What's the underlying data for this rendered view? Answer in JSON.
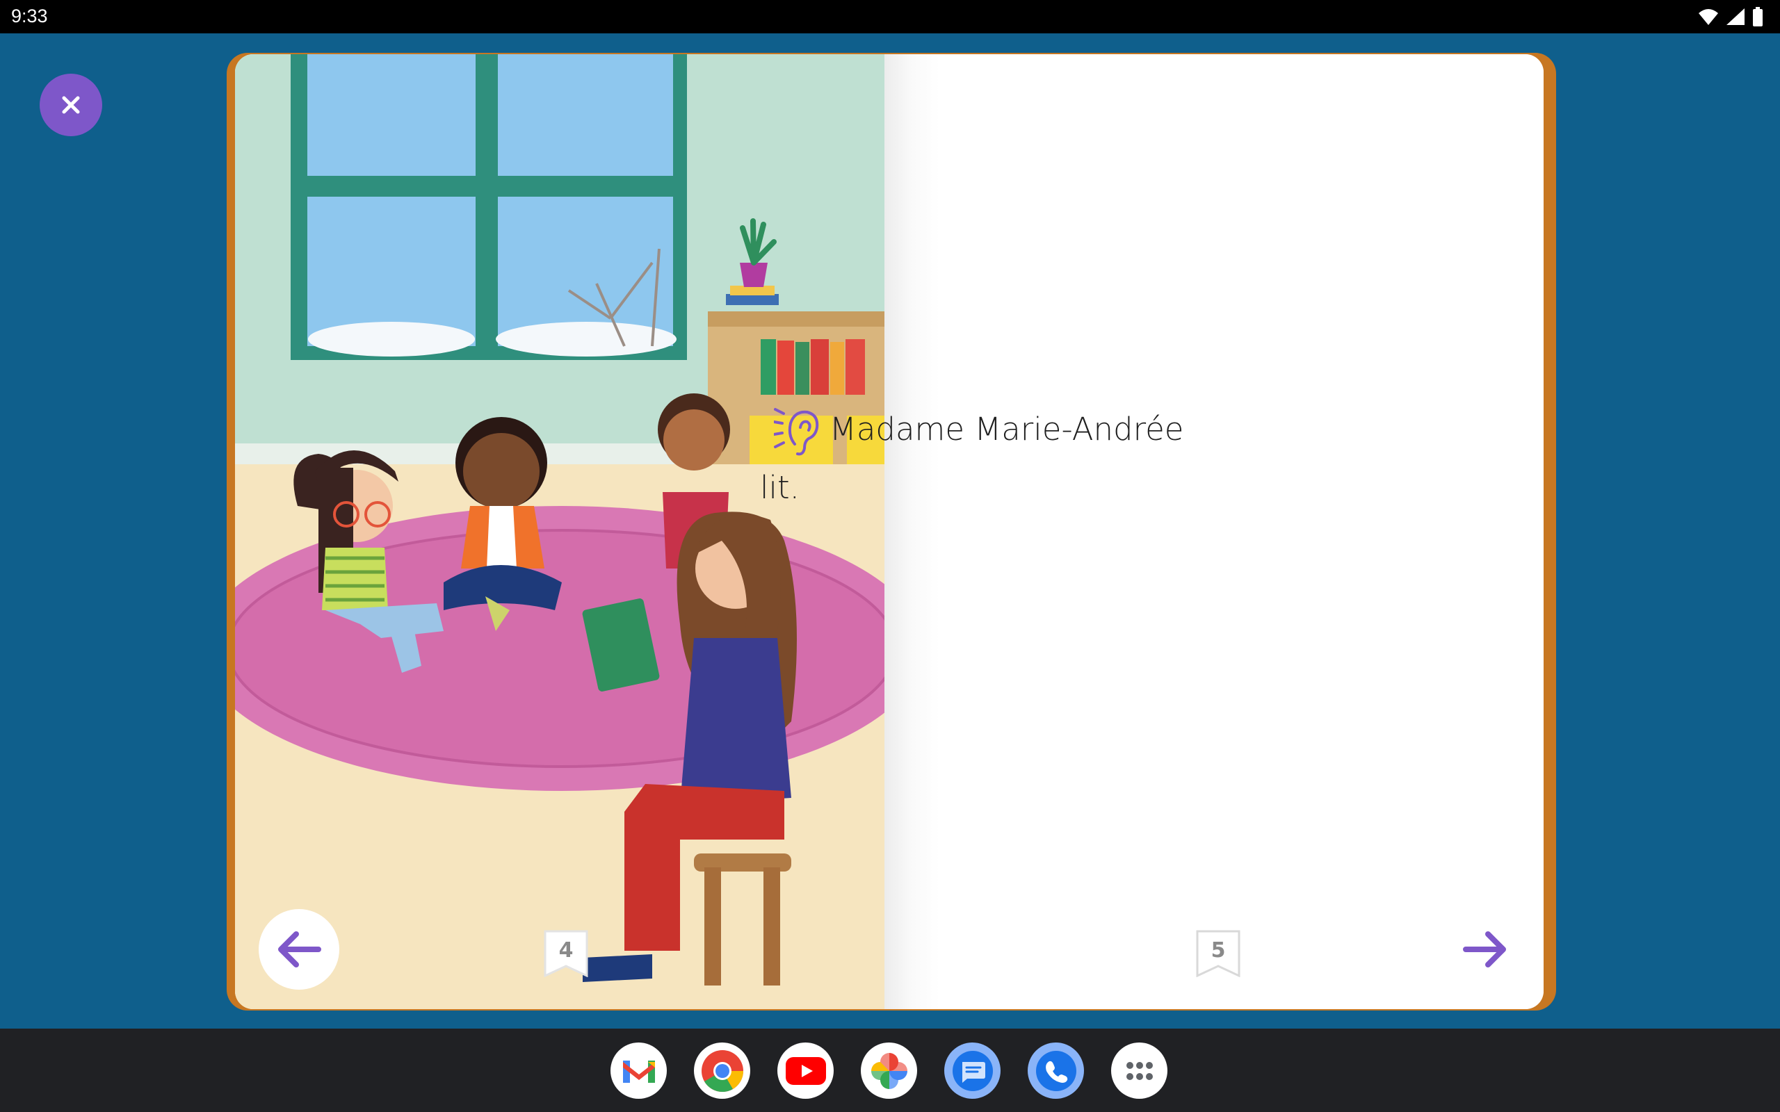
{
  "status_bar": {
    "time": "9:33"
  },
  "book": {
    "left_page_number": "4",
    "right_page_number": "5",
    "text_line_1": "Madame Marie-Andrée",
    "text_line_2": "lit."
  },
  "colors": {
    "accent": "#7e57c9",
    "background": "#0f5f8c",
    "book_edge": "#c77722"
  },
  "taskbar": {
    "apps": [
      "Gmail",
      "Chrome",
      "YouTube",
      "Photos",
      "Messages",
      "Phone",
      "App drawer"
    ]
  }
}
